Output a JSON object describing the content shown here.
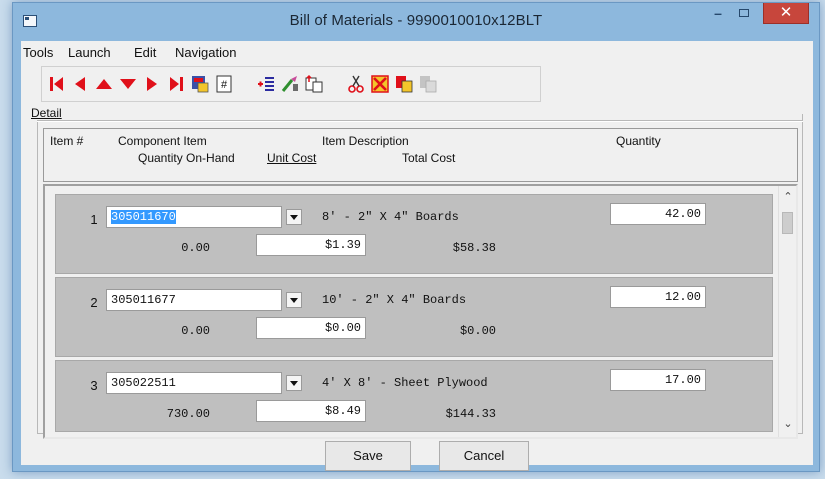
{
  "window": {
    "title": "Bill of Materials - 9990010010x12BLT",
    "minimize": "–",
    "close": "✕"
  },
  "menu": {
    "items": [
      "Tools",
      "Launch",
      "Edit",
      "Navigation"
    ]
  },
  "toolbar": {
    "buttons": [
      "first-record-icon",
      "previous-record-icon",
      "move-up-icon",
      "move-down-icon",
      "next-record-icon",
      "last-record-icon",
      "report-icon",
      "number-icon",
      "insert-row-icon",
      "edit-brush-icon",
      "paste-icon",
      "cut-icon",
      "delete-icon",
      "copy-icon",
      "copy-disabled-icon"
    ]
  },
  "detail": {
    "label": "Detail",
    "headers": {
      "item_num": "Item #",
      "component_item": "Component Item",
      "item_description": "Item Description",
      "quantity": "Quantity",
      "quantity_on_hand": "Quantity On-Hand",
      "unit_cost": "Unit Cost",
      "total_cost": "Total Cost"
    },
    "rows": [
      {
        "num": "1",
        "component": "305011670",
        "description": "8' - 2\" X 4\" Boards",
        "quantity": "42.00",
        "on_hand": "0.00",
        "unit_cost": "$1.39",
        "total_cost": "$58.38"
      },
      {
        "num": "2",
        "component": "305011677",
        "description": "10' - 2\" X 4\" Boards",
        "quantity": "12.00",
        "on_hand": "0.00",
        "unit_cost": "$0.00",
        "total_cost": "$0.00"
      },
      {
        "num": "3",
        "component": "305022511",
        "description": "4' X 8' - Sheet Plywood",
        "quantity": "17.00",
        "on_hand": "730.00",
        "unit_cost": "$8.49",
        "total_cost": "$144.33"
      }
    ]
  },
  "buttons": {
    "save": "Save",
    "cancel": "Cancel"
  },
  "colors": {
    "title_bar": "#8db8dd",
    "close_button": "#c7463c",
    "row_background": "#bfbfbf",
    "selection": "#3399ff",
    "toolbar_red": "#e0101a"
  }
}
